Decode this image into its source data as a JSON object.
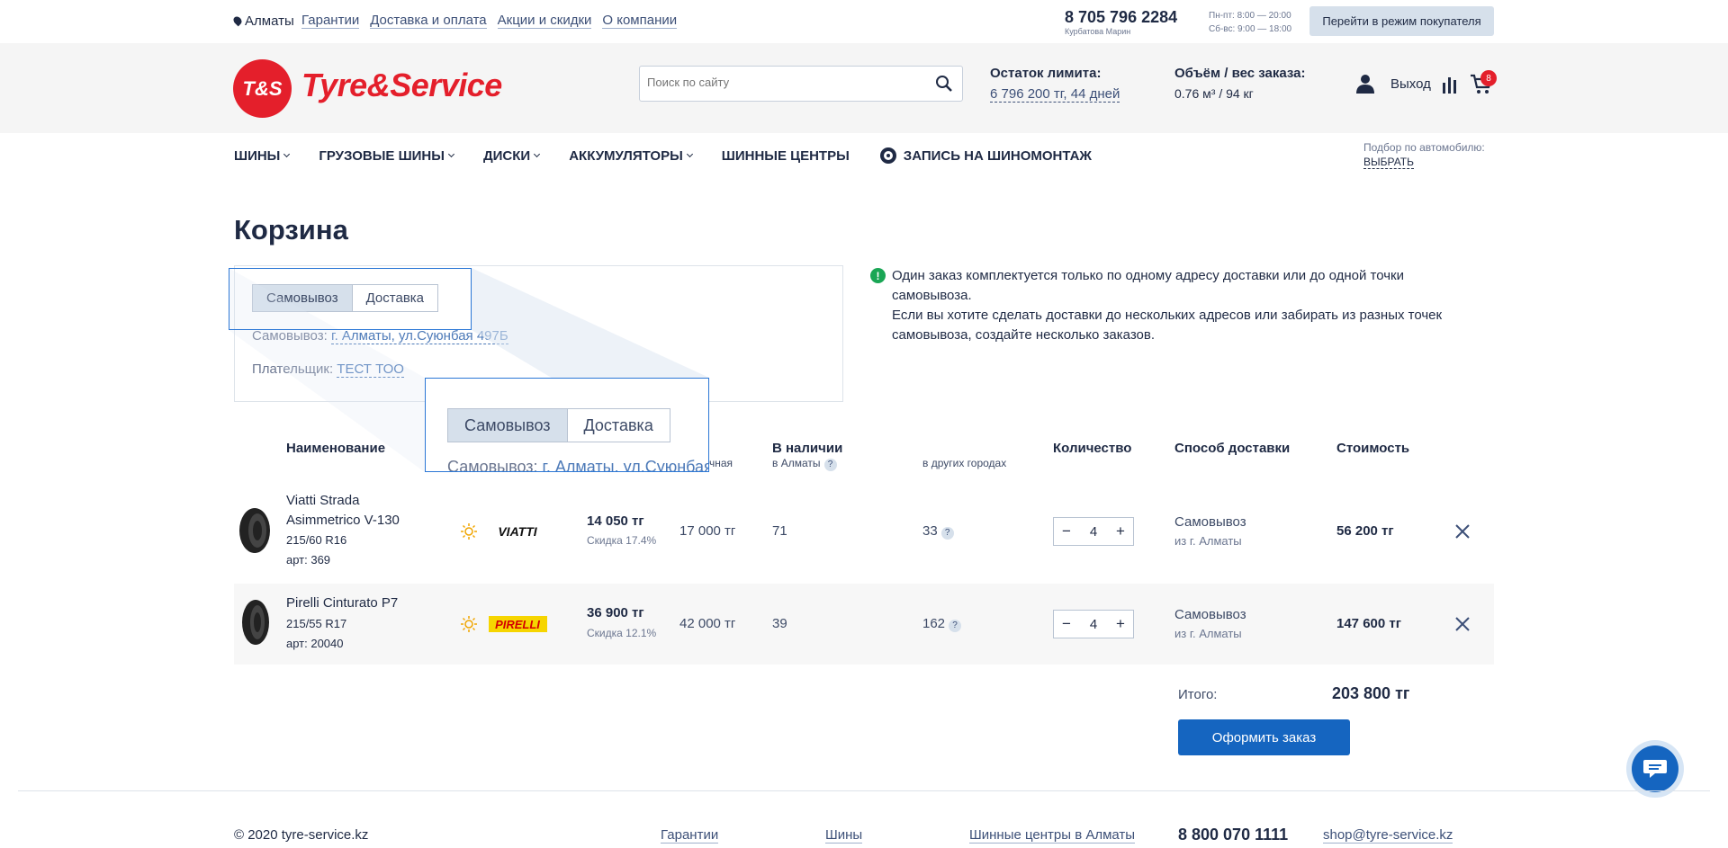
{
  "topbar": {
    "city": "Алматы",
    "links": [
      "Гарантии",
      "Доставка и оплата",
      "Акции и скидки",
      "О компании"
    ],
    "phone": "8 705 796 2284",
    "manager": "Курбатова Марин",
    "hours_weekday": "Пн-пт: 8:00 — 20:00",
    "hours_weekend": "Сб-вс: 9:00 — 18:00",
    "buyer_mode": "Перейти в режим покупателя"
  },
  "header": {
    "logo_mark": "T&S",
    "logo_text": "Tyre&Service",
    "search_placeholder": "Поиск по сайту",
    "limit_title": "Остаток лимита:",
    "limit_value": "6 796 200 тг, 44 дней",
    "volume_title": "Объём / вес заказа:",
    "volume_value": "0.76 м³ / 94 кг",
    "logout": "Выход",
    "cart_count": "8"
  },
  "nav": {
    "items": [
      "ШИНЫ",
      "ГРУЗОВЫЕ ШИНЫ",
      "ДИСКИ",
      "АККУМУЛЯТОРЫ",
      "ШИННЫЕ ЦЕНТРЫ"
    ],
    "booking": "ЗАПИСЬ НА ШИНОМОНТАЖ",
    "car_pick_label": "Подбор по автомобилю:",
    "car_pick_link": "ВЫБРАТЬ"
  },
  "page_title": "Корзина",
  "delivery": {
    "tab_pickup": "Самовывоз",
    "tab_delivery": "Доставка",
    "pickup_label": "Самовывоз:",
    "pickup_value": "г. Алматы, ул.Суюнбая 497Б",
    "payer_label": "Плательщик:",
    "payer_value": "ТЕСТ ТОО",
    "zoom_pickup_value": "г. Алматы, ул.Суюнбая"
  },
  "info": {
    "line1": "Один заказ комплектуется только по одному адресу доставки или до одной точки самовывоза.",
    "line2": "Если вы хотите сделать доставки до нескольких адресов или забирать из разных точек самовывоза, создайте несколько заказов."
  },
  "table": {
    "col_name": "Наименование",
    "col_retail_partial": "чная",
    "col_stock": "В наличии",
    "col_stock_sub": "в Алматы",
    "col_other": "в других городах",
    "col_qty": "Количество",
    "col_delivery": "Способ доставки",
    "col_cost": "Стоимость",
    "rows": [
      {
        "name1": "Viatti Strada",
        "name2": "Asimmetrico V-130",
        "size": "215/60 R16",
        "art": "арт: 369",
        "brand": "VIATTI",
        "price": "14 050 тг",
        "discount": "Скидка 17.4%",
        "retail": "17 000 тг",
        "stock": "71",
        "other": "33",
        "qty": "4",
        "delivery": "Самовывоз",
        "from": "из г. Алматы",
        "cost": "56 200 тг"
      },
      {
        "name1": "Pirelli Cinturato P7",
        "name2": "",
        "size": "215/55 R17",
        "art": "арт: 20040",
        "brand": "PIRELLI",
        "price": "36 900 тг",
        "discount": "Скидка 12.1%",
        "retail": "42 000 тг",
        "stock": "39",
        "other": "162",
        "qty": "4",
        "delivery": "Самовывоз",
        "from": "из г. Алматы",
        "cost": "147 600 тг"
      }
    ]
  },
  "summary": {
    "total_label": "Итого:",
    "total_value": "203 800 тг",
    "order_button": "Оформить заказ"
  },
  "footer": {
    "copyright": "© 2020 tyre-service.kz",
    "links": [
      "Гарантии",
      "Шины",
      "Шинные центры в Алматы"
    ],
    "phone": "8 800 070 1111",
    "email": "shop@tyre-service.kz"
  },
  "colors": {
    "brand_red": "#e41f2b",
    "primary_blue": "#1565c0",
    "highlight_blue": "#2b77d6",
    "info_green": "#1aa655"
  }
}
